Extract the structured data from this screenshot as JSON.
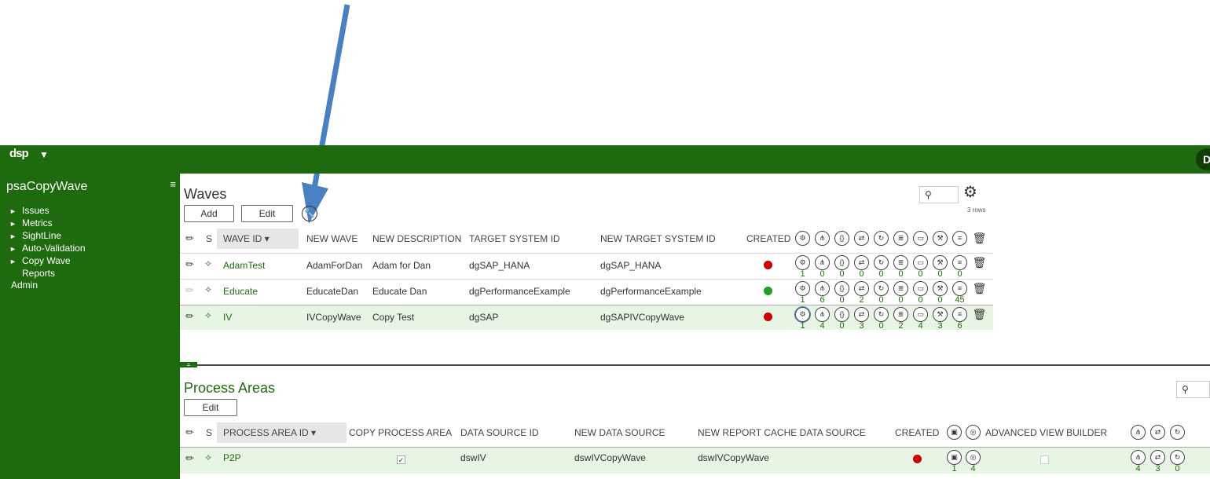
{
  "topbar": {
    "logo": "dsp",
    "caret": "▼",
    "avatar_initial": "D"
  },
  "sidebar": {
    "title": "psaCopyWave",
    "menu_icon": "≡",
    "items": [
      {
        "label": "Issues",
        "expandable": true
      },
      {
        "label": "Metrics",
        "expandable": true
      },
      {
        "label": "SightLine",
        "expandable": true
      },
      {
        "label": "Auto-Validation",
        "expandable": true
      },
      {
        "label": "Copy Wave",
        "expandable": true
      },
      {
        "label": "Reports",
        "expandable": false
      },
      {
        "label": "Admin",
        "expandable": false
      }
    ]
  },
  "waves": {
    "title": "Waves",
    "add_label": "Add",
    "edit_label": "Edit",
    "search_icon": "⚲",
    "rows_count": "3 rows",
    "columns": {
      "s": "S",
      "wave_id": "WAVE ID ▾",
      "new_wave": "NEW WAVE",
      "new_description": "NEW DESCRIPTION",
      "target_system_id": "TARGET SYSTEM ID",
      "new_target_system_id": "NEW TARGET SYSTEM ID",
      "created": "CREATED"
    },
    "icon_columns": [
      "process-icon",
      "hierarchy-icon",
      "braces-icon",
      "shuffle-icon",
      "refresh-icon",
      "database-icon",
      "card-icon",
      "wrench-icon",
      "doc-icon",
      "trash-icon"
    ],
    "rows": [
      {
        "wave_id": "AdamTest",
        "new_wave": "AdamForDan",
        "new_description": "Adam for Dan",
        "target_system_id": "dgSAP_HANA",
        "new_target_system_id": "dgSAP_HANA",
        "created_color": "#cc0000",
        "counts": [
          "1",
          "0",
          "0",
          "0",
          "0",
          "0",
          "0",
          "0",
          "0"
        ],
        "selected": false,
        "disabled": false
      },
      {
        "wave_id": "Educate",
        "new_wave": "EducateDan",
        "new_description": "Educate Dan",
        "target_system_id": "dgPerformanceExample",
        "new_target_system_id": "dgPerformanceExample",
        "created_color": "#22a022",
        "counts": [
          "1",
          "6",
          "0",
          "2",
          "0",
          "0",
          "0",
          "0",
          "45"
        ],
        "selected": false,
        "disabled": true
      },
      {
        "wave_id": "IV",
        "new_wave": "IVCopyWave",
        "new_description": "Copy Test",
        "target_system_id": "dgSAP",
        "new_target_system_id": "dgSAPIVCopyWave",
        "created_color": "#cc0000",
        "counts": [
          "1",
          "4",
          "0",
          "3",
          "0",
          "2",
          "4",
          "3",
          "6"
        ],
        "selected": true,
        "disabled": false
      }
    ]
  },
  "divider_handle": "=",
  "process_areas": {
    "title": "Process Areas",
    "edit_label": "Edit",
    "columns": {
      "s": "S",
      "process_area_id": "PROCESS AREA ID ▾",
      "copy_process_area": "COPY PROCESS AREA",
      "data_source_id": "DATA SOURCE ID",
      "new_data_source": "NEW DATA SOURCE",
      "new_report_cache_data_source": "NEW REPORT CACHE DATA SOURCE",
      "created": "CREATED",
      "advanced_view_builder": "ADVANCED VIEW BUILDER"
    },
    "rows": [
      {
        "process_area_id": "P2P",
        "copy_process_area": true,
        "data_source_id": "dswIV",
        "new_data_source": "dswIVCopyWave",
        "new_report_cache_data_source": "dswIVCopyWave",
        "created_color": "#cc0000",
        "counts_a": [
          "1",
          "4"
        ],
        "advanced_view_builder": false,
        "counts_b": [
          "4",
          "3",
          "0"
        ]
      }
    ]
  },
  "annotation": {
    "arrow_color": "#4a7fc1"
  }
}
